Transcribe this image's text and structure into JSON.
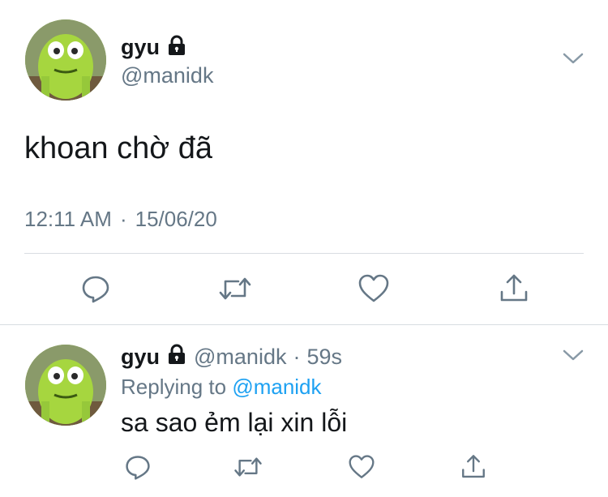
{
  "tweet": {
    "author_name": "gyu",
    "author_handle": "@manidk",
    "text": "khoan chờ đã",
    "time": "12:11 AM",
    "separator": "·",
    "date": "15/06/20"
  },
  "reply": {
    "author_name": "gyu",
    "author_handle": "@manidk",
    "separator": "·",
    "age": "59s",
    "replying_prefix": "Replying to",
    "replying_to": "@manidk",
    "text": "sa sao ẻm lại xin lỗi"
  },
  "icons": {
    "lock": "lock-icon",
    "caret": "chevron-down-icon",
    "reply": "comment-icon",
    "retweet": "retweet-icon",
    "like": "heart-icon",
    "share": "share-icon"
  },
  "colors": {
    "text": "#14171a",
    "secondary": "#657786",
    "link": "#1da1f2",
    "divider": "#d8dde1"
  }
}
